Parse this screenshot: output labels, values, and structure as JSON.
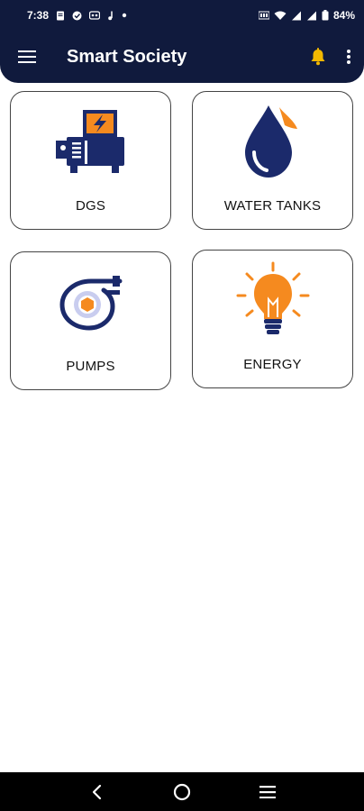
{
  "status_bar": {
    "time": "7:38",
    "battery": "84%",
    "icons": [
      "document-icon",
      "check-circle-icon",
      "game-icon",
      "music-icon",
      "dot-icon",
      "volte-icon",
      "wifi-icon",
      "signal-icon",
      "signal-icon",
      "battery-icon"
    ]
  },
  "app_bar": {
    "title": "Smart Society",
    "menu_icon": "hamburger-menu-icon",
    "notification_icon": "bell-icon",
    "overflow_icon": "more-vert-icon"
  },
  "tiles": [
    {
      "label": "DGS",
      "icon": "generator-icon"
    },
    {
      "label": "WATER TANKS",
      "icon": "water-drop-icon"
    },
    {
      "label": "PUMPS",
      "icon": "pump-icon"
    },
    {
      "label": "ENERGY",
      "icon": "light-bulb-icon"
    }
  ],
  "nav_bar": {
    "icons": [
      "back-icon",
      "home-icon",
      "recents-icon"
    ]
  },
  "colors": {
    "primary": "#101a3d",
    "accent": "#f58a1f",
    "icon_navy": "#1b2a6b",
    "bell": "#f2b800"
  }
}
